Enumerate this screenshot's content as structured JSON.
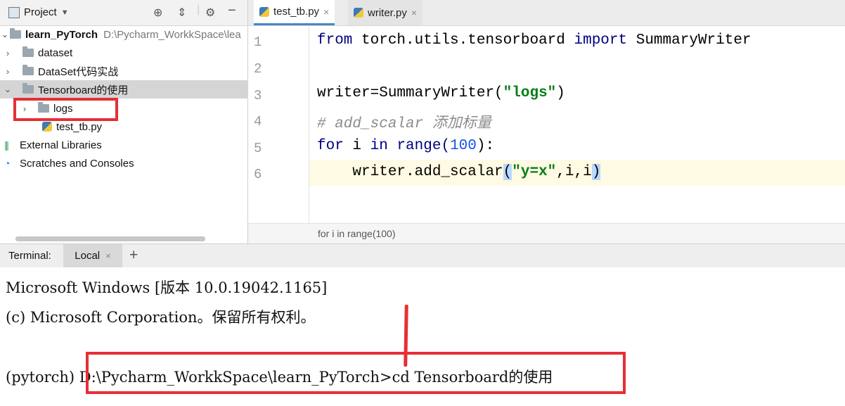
{
  "project": {
    "title": "Project",
    "tree": [
      {
        "label": "learn_PyTorch",
        "hint": "D:\\Pycharm_WorkkSpace\\lea"
      },
      {
        "label": "dataset"
      },
      {
        "label": "DataSet代码实战"
      },
      {
        "label": "Tensorboard的使用"
      },
      {
        "label": "logs"
      },
      {
        "label": "test_tb.py"
      },
      {
        "label": "External Libraries"
      },
      {
        "label": "Scratches and Consoles"
      }
    ]
  },
  "editor": {
    "tabs": [
      {
        "label": "test_tb.py"
      },
      {
        "label": "writer.py"
      }
    ],
    "line_numbers": [
      "1",
      "2",
      "3",
      "4",
      "5",
      "6"
    ],
    "code": {
      "l1_kw1": "from",
      "l1_mod": " torch.utils.tensorboard ",
      "l1_kw2": "import",
      "l1_name": " SummaryWriter",
      "l3_a": "writer=SummaryWriter(",
      "l3_str": "\"logs\"",
      "l3_b": ")",
      "l4_cmt": "# add_scalar 添加标量",
      "l5_kw1": "for",
      "l5_a": " i ",
      "l5_kw2": "in",
      "l5_b": " range(",
      "l5_num": "100",
      "l5_c": "):",
      "l6_a": "    writer.add_scalar",
      "l6_paren_open": "(",
      "l6_str": "\"y=x\"",
      "l6_b": ",i,i",
      "l6_paren_close": ")"
    },
    "breadcrumb": "for i in range(100)"
  },
  "terminal": {
    "label": "Terminal:",
    "tab": "Local",
    "lines": [
      "Microsoft Windows [版本 10.0.19042.1165]",
      "(c) Microsoft Corporation。保留所有权利。",
      "",
      "(pytorch) D:\\Pycharm_WorkkSpace\\learn_PyTorch>cd Tensorboard的使用"
    ]
  },
  "colors": {
    "highlight_box": "#e53035",
    "selection": "#d5d5d5",
    "keyword": "#000080",
    "string": "#067d17",
    "number": "#1750eb",
    "comment": "#8c8c8c"
  }
}
